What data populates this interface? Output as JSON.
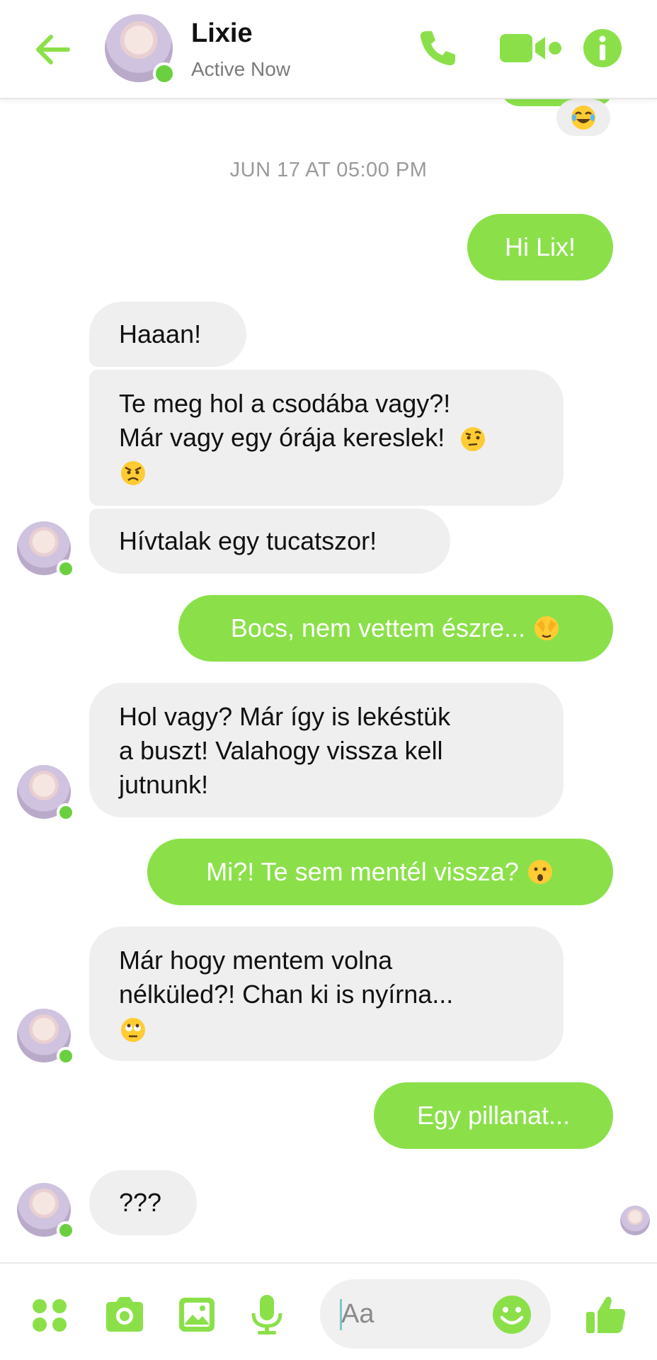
{
  "header": {
    "contact_name": "Lixie",
    "status": "Active Now"
  },
  "accent_color": "#8be04a",
  "online_color": "#6ccf3f",
  "conversation": {
    "timestamp": "JUN 17 AT 05:00 PM",
    "reaction_emoji": "face-with-tears-of-joy",
    "messages": [
      {
        "from": "me",
        "text": "Hi Lix!"
      },
      {
        "from": "them",
        "text": "Haaan!"
      },
      {
        "from": "them",
        "text": "Te meg hol a csodába vagy?!\nMár vagy egy órája kereslek!",
        "emoji": [
          "face-with-raised-eyebrow",
          "angry-face"
        ]
      },
      {
        "from": "them",
        "text": "Hívtalak egy tucatszor!"
      },
      {
        "from": "me",
        "text": "Bocs, nem vettem észre...",
        "emoji": [
          "face-with-hand-over-eyes"
        ]
      },
      {
        "from": "them",
        "text": "Hol vagy? Már így is lekéstük\na buszt! Valahogy vissza kell\njutnunk!"
      },
      {
        "from": "me",
        "text": "Mi?! Te sem mentél vissza?",
        "emoji": [
          "hushed-face"
        ]
      },
      {
        "from": "them",
        "text": "Már hogy mentem volna\nnélküled?! Chan ki is nyírna...",
        "emoji": [
          "face-with-rolling-eyes"
        ]
      },
      {
        "from": "me",
        "text": "Egy pillanat..."
      },
      {
        "from": "them",
        "text": "???"
      }
    ]
  },
  "composer": {
    "placeholder": "Aa"
  },
  "icons": [
    "back-arrow-icon",
    "phone-icon",
    "video-camera-icon",
    "info-icon",
    "apps-icon",
    "camera-icon",
    "image-icon",
    "microphone-icon",
    "emoji-icon",
    "thumbs-up-icon"
  ]
}
